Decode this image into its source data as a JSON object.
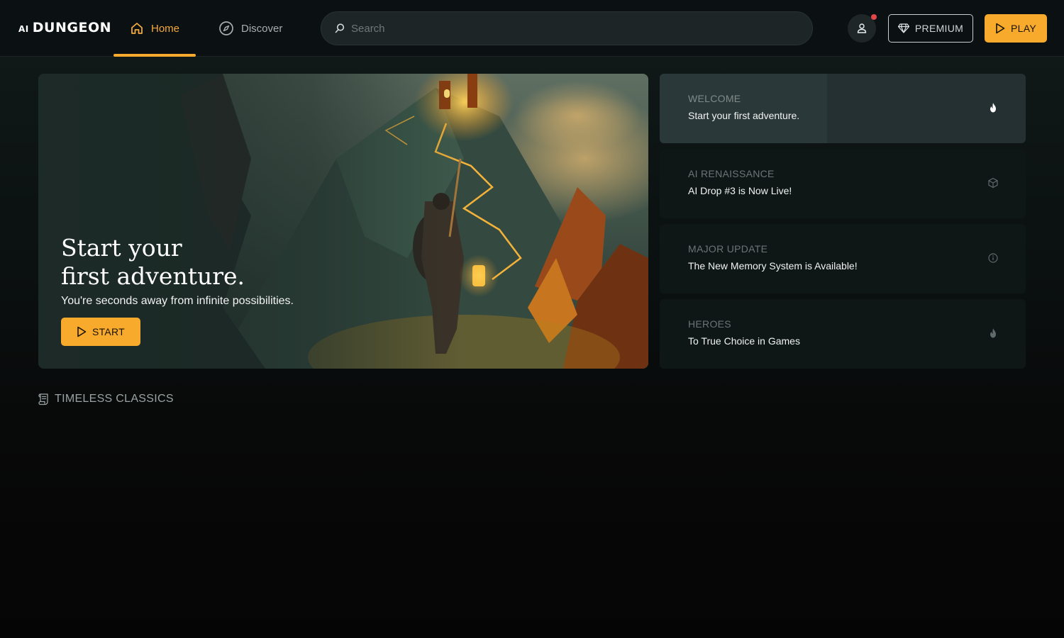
{
  "app": {
    "logo_prefix": "AI",
    "logo_word": "DUNGEON"
  },
  "nav": {
    "tabs": [
      {
        "label": "Home",
        "icon": "home-icon",
        "active": true
      },
      {
        "label": "Discover",
        "icon": "compass-icon",
        "active": false
      }
    ]
  },
  "search": {
    "placeholder": "Search",
    "value": ""
  },
  "header_actions": {
    "profile_icon": "user-icon",
    "notification_dot_color": "#e2464a",
    "premium_label": "PREMIUM",
    "play_label": "PLAY"
  },
  "hero": {
    "title": "Start your\nfirst adventure.",
    "subtitle": "You're seconds away from infinite possibilities.",
    "button_label": "START"
  },
  "news": [
    {
      "category": "WELCOME",
      "headline": "Start your first adventure.",
      "icon": "flame-icon",
      "active": true
    },
    {
      "category": "AI RENAISSANCE",
      "headline": "AI Drop #3 is Now Live!",
      "icon": "cube-icon",
      "active": false
    },
    {
      "category": "MAJOR UPDATE",
      "headline": "The New Memory System is Available!",
      "icon": "info-icon",
      "active": false
    },
    {
      "category": "HEROES",
      "headline": "To True Choice in Games",
      "icon": "flame-icon",
      "active": false
    }
  ],
  "sections": {
    "classics_title": "TIMELESS CLASSICS",
    "classics_icon": "scroll-icon"
  },
  "colors": {
    "accent": "#f7aa2c",
    "background": "#0b1112",
    "card": "#0f1616",
    "card_active": "#243031"
  }
}
